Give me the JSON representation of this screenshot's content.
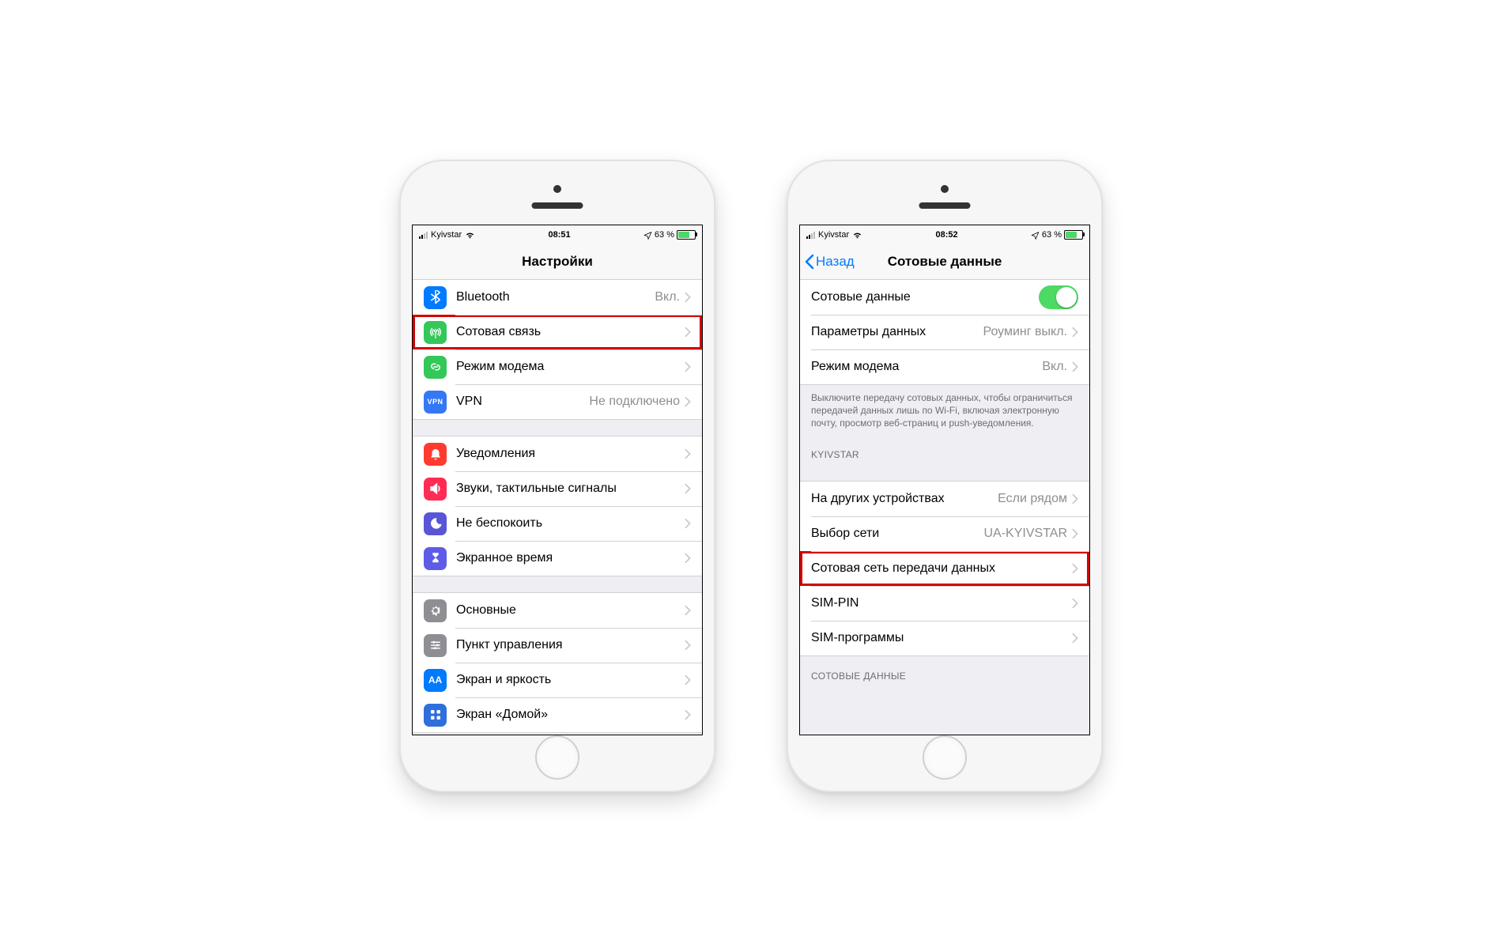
{
  "phone_left": {
    "status": {
      "carrier": "Kyivstar",
      "time": "08:51",
      "battery_pct": "63 %"
    },
    "nav": {
      "title": "Настройки"
    },
    "group1": [
      {
        "icon": "bluetooth",
        "color": "bg-blue",
        "label": "Bluetooth",
        "value": "Вкл."
      },
      {
        "icon": "antenna",
        "color": "bg-green",
        "label": "Сотовая связь",
        "value": "",
        "highlight": true
      },
      {
        "icon": "link",
        "color": "bg-green2",
        "label": "Режим модема",
        "value": ""
      },
      {
        "icon": "vpn",
        "color": "bg-blue2",
        "label": "VPN",
        "value": "Не подключено"
      }
    ],
    "group2": [
      {
        "icon": "bell",
        "color": "bg-red",
        "label": "Уведомления",
        "value": ""
      },
      {
        "icon": "speaker",
        "color": "bg-pink",
        "label": "Звуки, тактильные сигналы",
        "value": ""
      },
      {
        "icon": "moon",
        "color": "bg-purple",
        "label": "Не беспокоить",
        "value": ""
      },
      {
        "icon": "hourglass",
        "color": "bg-indigo",
        "label": "Экранное время",
        "value": ""
      }
    ],
    "group3": [
      {
        "icon": "gear",
        "color": "bg-gray",
        "label": "Основные",
        "value": ""
      },
      {
        "icon": "sliders",
        "color": "bg-gray2",
        "label": "Пункт управления",
        "value": ""
      },
      {
        "icon": "aa",
        "color": "bg-blue3",
        "label": "Экран и яркость",
        "value": ""
      },
      {
        "icon": "grid",
        "color": "bg-blue4",
        "label": "Экран «Домой»",
        "value": ""
      }
    ]
  },
  "phone_right": {
    "status": {
      "carrier": "Kyivstar",
      "time": "08:52",
      "battery_pct": "63 %"
    },
    "nav": {
      "back": "Назад",
      "title": "Сотовые данные"
    },
    "group1": {
      "row1": {
        "label": "Сотовые данные",
        "toggle": true
      },
      "row2": {
        "label": "Параметры данных",
        "value": "Роуминг выкл."
      },
      "row3": {
        "label": "Режим модема",
        "value": "Вкл."
      }
    },
    "note": "Выключите передачу сотовых данных, чтобы ограничиться передачей данных лишь по Wi-Fi, включая электронную почту, просмотр веб-страниц и push-уведомления.",
    "section_header": "KYIVSTAR",
    "group2": [
      {
        "label": "На других устройствах",
        "value": "Если рядом"
      },
      {
        "label": "Выбор сети",
        "value": "UA-KYIVSTAR"
      },
      {
        "label": "Сотовая сеть передачи данных",
        "value": "",
        "highlight": true
      },
      {
        "label": "SIM-PIN",
        "value": ""
      },
      {
        "label": "SIM-программы",
        "value": ""
      }
    ],
    "footer_header": "СОТОВЫЕ ДАННЫЕ"
  }
}
